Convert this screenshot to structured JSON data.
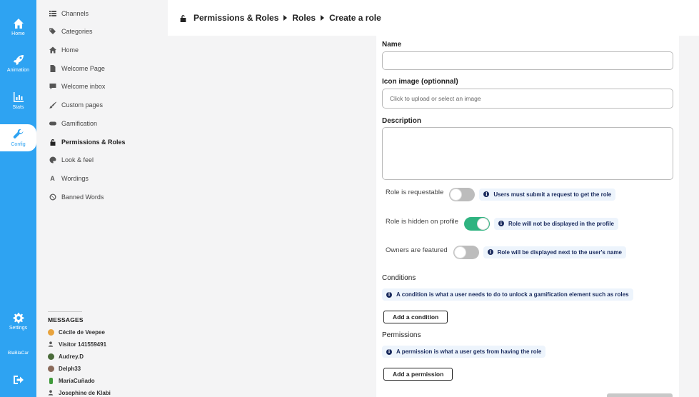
{
  "rail": {
    "home": "Home",
    "animation": "Animation",
    "stats": "Stats",
    "config": "Config",
    "settings": "Settings",
    "brand": "BlaBlaCar"
  },
  "menu": {
    "items": [
      "Channels",
      "Categories",
      "Home",
      "Welcome Page",
      "Welcome inbox",
      "Custom pages",
      "Gamification",
      "Permissions & Roles",
      "Look & feel",
      "Wordings",
      "Banned Words"
    ]
  },
  "messages": {
    "title": "MESSAGES",
    "items": [
      "Cécile de Veepee",
      "Visitor 141559491",
      "Audrey.D",
      "Delph33",
      "MaríaCuñado",
      "Josephine de Klabi"
    ]
  },
  "header": {
    "crumbs": [
      "Permissions & Roles",
      "Roles",
      "Create a role"
    ]
  },
  "form": {
    "name_label": "Name",
    "icon_label": "Icon image (optionnal)",
    "icon_placeholder": "Click to upload or select an image",
    "description_label": "Description",
    "requestable_label": "Role is requestable",
    "requestable_info": "Users must submit a request to get the role",
    "hidden_label": "Role is hidden on profile",
    "hidden_info": "Role will not be displayed in the profile",
    "owners_label": "Owners are featured",
    "owners_info": "Role will be displayed next to the user's name",
    "conditions_title": "Conditions",
    "conditions_info": "A condition is what a user needs to do to unlock a gamification element such as roles",
    "add_condition": "Add a condition",
    "permissions_title": "Permissions",
    "permissions_info": "A permission is what a user gets from having the role",
    "add_permission": "Add a permission"
  },
  "colors": {
    "rail": "#2ea3f2",
    "toggle_on": "#2fb380",
    "info_text": "#1a2b5e"
  }
}
